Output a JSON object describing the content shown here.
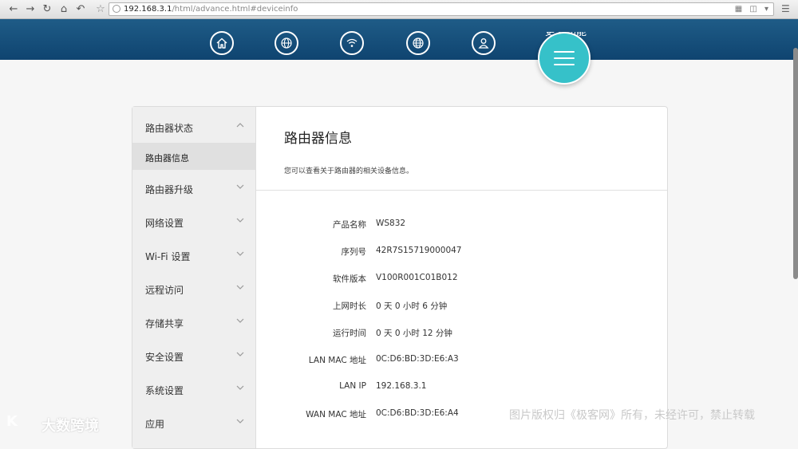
{
  "browser": {
    "url_host": "192.168.3.1",
    "url_path": "/html/advance.html#deviceinfo",
    "icons": [
      "back-arrow",
      "forward-arrow",
      "reload",
      "home",
      "undo",
      "star",
      "page-info",
      "qr-code",
      "translate",
      "dropdown",
      "menu"
    ]
  },
  "header": {
    "more_label": "更多功能",
    "nav_icons": [
      "home-icon",
      "globe-icon",
      "wifi-icon",
      "globe-settings-icon",
      "user-icon"
    ],
    "menu_icon": "menu-icon",
    "colors": {
      "bar": "#164f7c",
      "fab": "#36c1c9"
    }
  },
  "sidebar": {
    "items": [
      {
        "label": "路由器状态",
        "expanded": true
      },
      {
        "label": "路由器信息",
        "selected": true,
        "sub": true
      },
      {
        "label": "路由器升级"
      },
      {
        "label": "网络设置"
      },
      {
        "label": "Wi-Fi 设置"
      },
      {
        "label": "远程访问"
      },
      {
        "label": "存储共享"
      },
      {
        "label": "安全设置"
      },
      {
        "label": "系统设置"
      },
      {
        "label": "应用"
      }
    ]
  },
  "main": {
    "title": "路由器信息",
    "description": "您可以查看关于路由器的相关设备信息。",
    "rows": [
      {
        "key": "产品名称",
        "value": "WS832"
      },
      {
        "key": "序列号",
        "value": "42R7S15719000047"
      },
      {
        "key": "软件版本",
        "value": "V100R001C01B012"
      },
      {
        "key": "上网时长",
        "value": "0 天 0 小时 6 分钟"
      },
      {
        "key": "运行时间",
        "value": "0 天 0 小时 12 分钟"
      },
      {
        "key": "LAN MAC 地址",
        "value": "0C:D6:BD:3D:E6:A3"
      },
      {
        "key": "LAN IP",
        "value": "192.168.3.1"
      },
      {
        "key": "WAN MAC 地址",
        "value": "0C:D6:BD:3D:E6:A4"
      }
    ]
  },
  "watermarks": {
    "logo_glyph": "K",
    "logo_text": "大数跨境",
    "right_text": "图片版权归《极客网》所有，未经许可，禁止转载"
  }
}
